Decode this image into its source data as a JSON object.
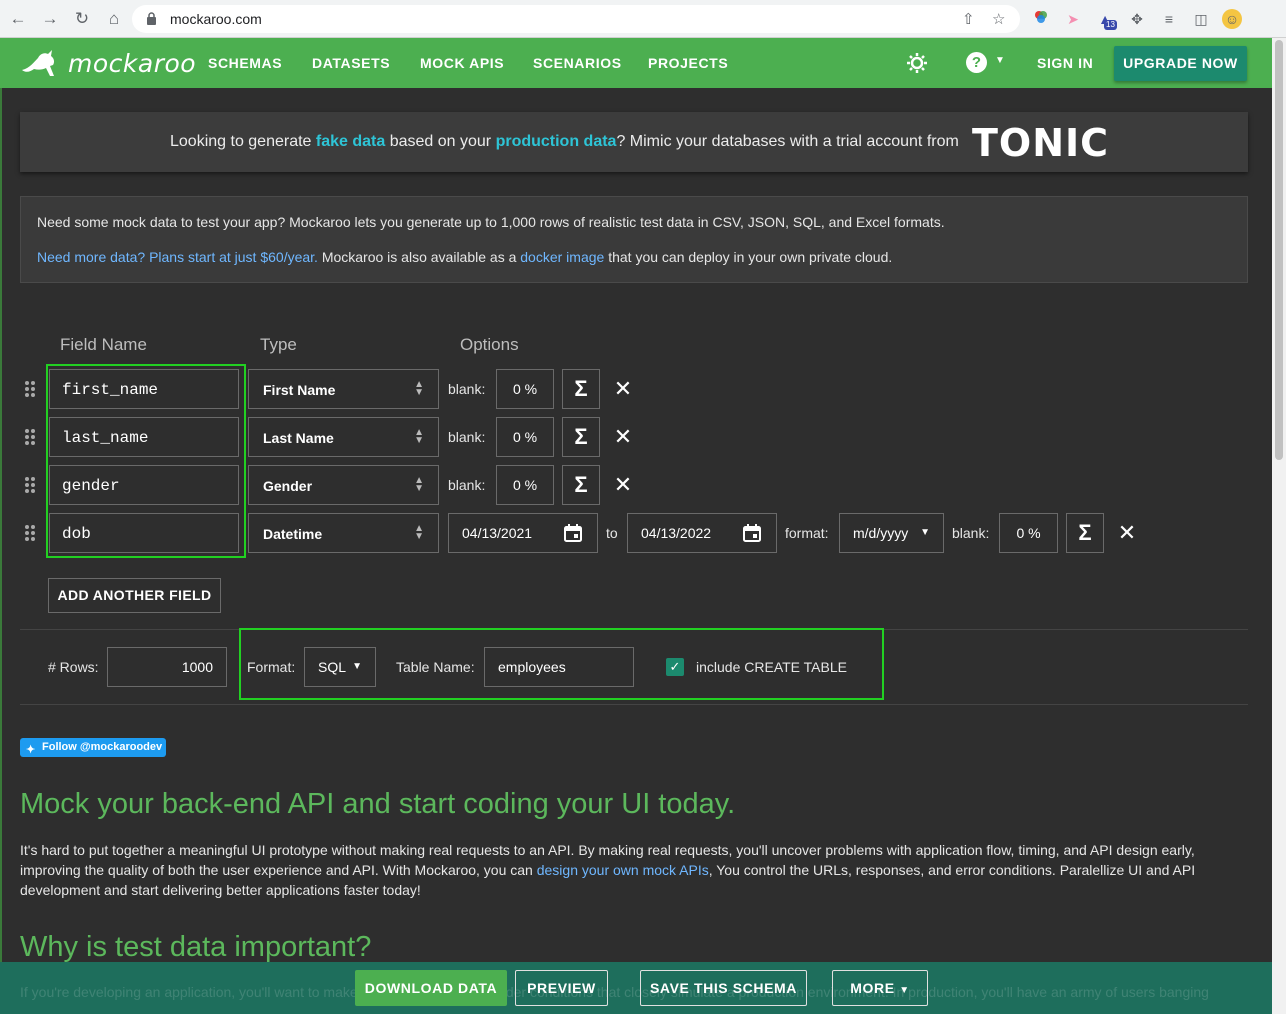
{
  "browser": {
    "url": "mockaroo.com",
    "badge_count": "13"
  },
  "header": {
    "logo_text": "mockaroo",
    "nav": [
      "SCHEMAS",
      "DATASETS",
      "MOCK APIS",
      "SCENARIOS",
      "PROJECTS"
    ],
    "sign_in": "SIGN IN",
    "upgrade": "UPGRADE NOW"
  },
  "tonic": {
    "text1": "Looking to generate ",
    "hl1": "fake data",
    "text2": " based on your ",
    "hl2": "production data",
    "text3": "? Mimic your databases with a trial account from",
    "brand": "TONIC"
  },
  "info": {
    "line1": "Need some mock data to test your app? Mockaroo lets you generate up to 1,000 rows of realistic test data in CSV, JSON, SQL, and Excel formats.",
    "link1": "Need more data? Plans start at just $60/year.",
    "text2": " Mockaroo is also available as a ",
    "link2": "docker image",
    "text3": " that you can deploy in your own private cloud."
  },
  "columns": {
    "field_name": "Field Name",
    "type": "Type",
    "options": "Options"
  },
  "fields": [
    {
      "name": "first_name",
      "type": "First Name",
      "blank_label": "blank:",
      "blank": "0 %"
    },
    {
      "name": "last_name",
      "type": "Last Name",
      "blank_label": "blank:",
      "blank": "0 %"
    },
    {
      "name": "gender",
      "type": "Gender",
      "blank_label": "blank:",
      "blank": "0 %"
    },
    {
      "name": "dob",
      "type": "Datetime",
      "from": "04/13/2021",
      "to_label": "to",
      "to": "04/13/2022",
      "format_label": "format:",
      "format": "m/d/yyyy",
      "blank_label": "blank:",
      "blank": "0 %"
    }
  ],
  "add_field": "ADD ANOTHER FIELD",
  "settings": {
    "rows_label": "# Rows:",
    "rows": "1000",
    "format_label": "Format:",
    "format": "SQL",
    "table_label": "Table Name:",
    "table": "employees",
    "create_table": "include CREATE TABLE"
  },
  "twitter": "Follow @mockaroodev",
  "section1": {
    "title": "Mock your back-end API and start coding your UI today.",
    "p1": "It's hard to put together a meaningful UI prototype without making real requests to an API. By making real requests, you'll uncover problems with application flow, timing, and API design early, improving the quality of both the user experience and API. With Mockaroo, you can ",
    "link": "design your own mock APIs",
    "p2": ", You control the URLs, responses, and error conditions. Paralellize UI and API development and start delivering better applications faster today!"
  },
  "section2": {
    "title": "Why is test data important?",
    "ghost": "If you're developing an application, you'll want to make sure you're testing it under conditions that closely simulate a production environment. In production, you'll have an army of users banging"
  },
  "footer": {
    "download": "DOWNLOAD DATA",
    "preview": "PREVIEW",
    "save": "SAVE THIS SCHEMA",
    "more": "MORE"
  }
}
